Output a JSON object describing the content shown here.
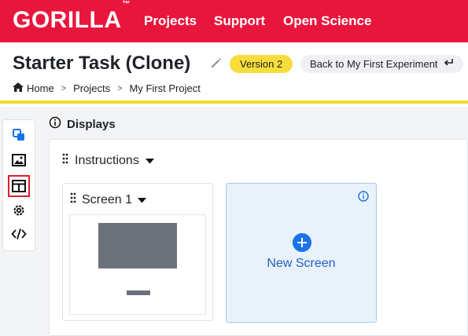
{
  "topbar": {
    "logo": "GORILLA",
    "logo_mark": "™",
    "nav": [
      "Projects",
      "Support",
      "Open Science"
    ],
    "bg_color": "#e8163d"
  },
  "header": {
    "title": "Starter Task (Clone)",
    "edit_icon": "pencil-icon",
    "version_badge": "Version 2",
    "back_button": "Back to My First Experiment",
    "breadcrumb": [
      "Home",
      "Projects",
      "My First Project"
    ]
  },
  "sidebar": {
    "icons": [
      "copy-icon",
      "image-icon",
      "table-icon",
      "gear-icon",
      "code-icon"
    ],
    "selected": "table-icon"
  },
  "displays": {
    "heading": "Displays",
    "section": "Instructions",
    "screens": [
      {
        "label": "Screen 1"
      }
    ],
    "new_screen_label": "New Screen"
  }
}
